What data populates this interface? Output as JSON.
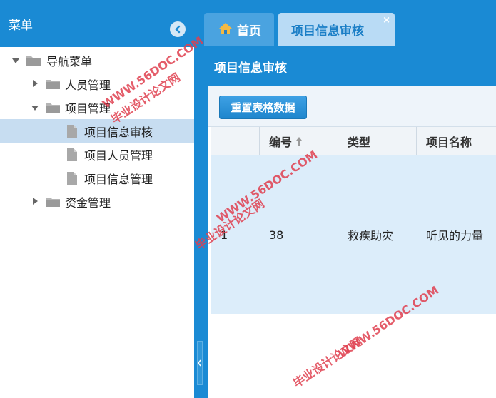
{
  "menu": {
    "title": "菜单",
    "tree": [
      {
        "label": "导航菜单",
        "level": 0,
        "expanded": true,
        "type": "folder"
      },
      {
        "label": "人员管理",
        "level": 1,
        "expanded": false,
        "type": "folder"
      },
      {
        "label": "项目管理",
        "level": 1,
        "expanded": true,
        "type": "folder"
      },
      {
        "label": "项目信息审核",
        "level": 2,
        "type": "file",
        "selected": true
      },
      {
        "label": "项目人员管理",
        "level": 2,
        "type": "file"
      },
      {
        "label": "项目信息管理",
        "level": 2,
        "type": "file"
      },
      {
        "label": "资金管理",
        "level": 1,
        "expanded": false,
        "type": "folder"
      }
    ]
  },
  "tabs": {
    "home_label": "首页",
    "active_label": "项目信息审核",
    "close_glyph": "×"
  },
  "panel": {
    "title": "项目信息审核",
    "reset_button": "重置表格数据"
  },
  "grid": {
    "columns": [
      "",
      "编号",
      "类型",
      "项目名称"
    ],
    "sorted_column": "编号",
    "rows": [
      [
        "1",
        "38",
        "救疾助灾",
        "听见的力量"
      ]
    ]
  },
  "watermark": {
    "line1": "WWW.56DOC.COM",
    "line2": "毕业设计论文网"
  },
  "colors": {
    "primary": "#1a8ad4",
    "selected_row": "#dcedfa",
    "selected_menu": "#c7ddf1",
    "watermark": "#e04050"
  }
}
